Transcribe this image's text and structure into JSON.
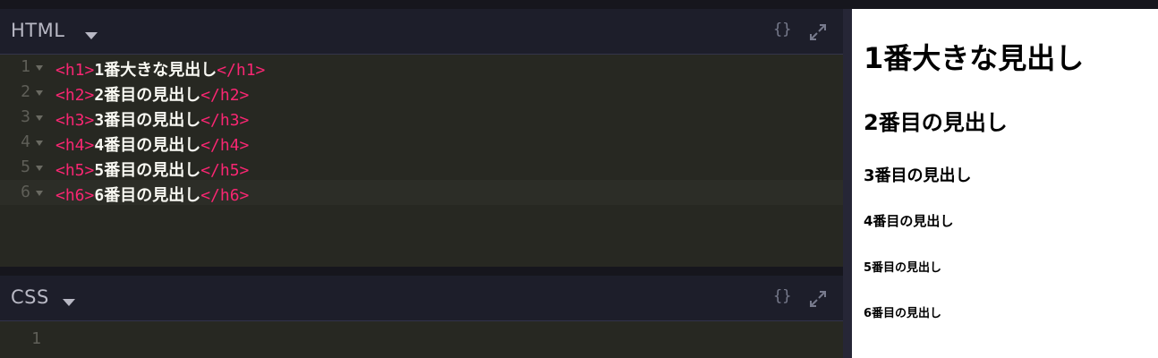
{
  "html_panel": {
    "title": "HTML",
    "format_button_label": "{}",
    "lines": [
      {
        "num": "1",
        "open": "<h1>",
        "text": "1番大きな見出し",
        "close": "</h1>"
      },
      {
        "num": "2",
        "open": "<h2>",
        "text": "2番目の見出し",
        "close": "</h2>"
      },
      {
        "num": "3",
        "open": "<h3>",
        "text": "3番目の見出し",
        "close": "</h3>"
      },
      {
        "num": "4",
        "open": "<h4>",
        "text": "4番目の見出し",
        "close": "</h4>"
      },
      {
        "num": "5",
        "open": "<h5>",
        "text": "5番目の見出し",
        "close": "</h5>"
      },
      {
        "num": "6",
        "open": "<h6>",
        "text": "6番目の見出し",
        "close": "</h6>"
      }
    ]
  },
  "css_panel": {
    "title": "CSS",
    "format_button_label": "{}",
    "lines": [
      {
        "num": "1"
      }
    ]
  },
  "preview": {
    "headings": [
      "1番大きな見出し",
      "2番目の見出し",
      "3番目の見出し",
      "4番目の見出し",
      "5番目の見出し",
      "6番目の見出し"
    ]
  },
  "colors": {
    "tag": "#f92672",
    "editor_bg": "#272822",
    "header_bg": "#1d1e2a"
  },
  "icons": [
    "chevron-down-icon",
    "format-braces-icon",
    "expand-icon"
  ]
}
